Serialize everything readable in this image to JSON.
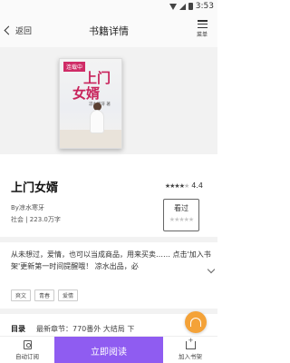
{
  "status_bar": {
    "time": "3:53"
  },
  "header": {
    "back_label": "返回",
    "title": "书籍详情",
    "menu_label": "菜单"
  },
  "cover": {
    "tag": "连载中",
    "title_line1": "上门",
    "title_line2": "女婿",
    "author_text": "凉水寒牙 著"
  },
  "book": {
    "title": "上门女婿",
    "rating_score": "4.4",
    "rating_stars": 4,
    "author_line": "By凉水寒牙",
    "meta_line": "社会 | 223.0万字"
  },
  "rate_box": {
    "label": "看过",
    "stars": "★★★★★"
  },
  "description": "从未想过，爱情，也可以当成商品，用来买卖…… 点击'加入书架'更新第一时间提醒哦！ 凉水出品，必",
  "tags": [
    "爽文",
    "青春",
    "爱情"
  ],
  "toc": {
    "label": "目录",
    "latest": "最新章节：770番外 大结局 下"
  },
  "bottom_bar": {
    "auto_subscribe": "自动订阅",
    "read_now": "立即阅读",
    "add_shelf": "加入书架"
  },
  "colors": {
    "accent": "#8f5cf1",
    "fab": "#f4a238",
    "cover_tag": "#cf2b66"
  },
  "icons": {
    "back": "chevron-left-icon",
    "menu": "menu-icon",
    "fab": "headphones-icon",
    "auto_subscribe": "subscribe-icon",
    "add_shelf": "bookshelf-add-icon"
  }
}
